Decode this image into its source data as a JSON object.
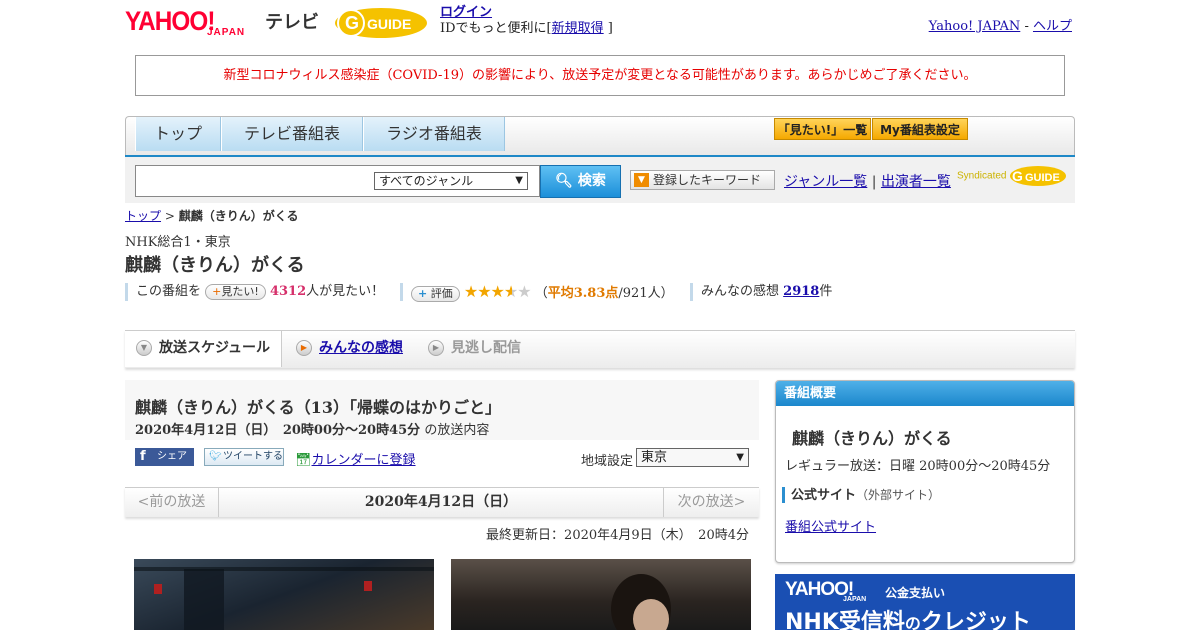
{
  "header": {
    "logo_yahoo": "YAHOO!",
    "logo_japan": "JAPAN",
    "logo_tv": "テレビ",
    "logo_gguide": "G GUIDE",
    "login_label": "ログイン",
    "id_text_prefix": "IDでもっと便利に[",
    "signup_label": "新規取得",
    "id_text_suffix": "]",
    "yahoo_japan_link": "Yahoo! JAPAN",
    "separator": "-",
    "help_link": "ヘルプ"
  },
  "notice": "新型コロナウィルス感染症（COVID-19）の影響により、放送予定が変更となる可能性があります。あらかじめご了承ください。",
  "nav": {
    "tabs": [
      "トップ",
      "テレビ番組表",
      "ラジオ番組表"
    ],
    "btn_mitai": "「見たい!」一覧",
    "btn_my": "My番組表設定"
  },
  "search": {
    "placeholder": "",
    "genre": "すべてのジャンル",
    "button": "検索",
    "keyword_btn": "登録したキーワード",
    "genre_list": "ジャンル一覧",
    "divider": "|",
    "performer_list": "出演者一覧",
    "syndicated": "Syndicated"
  },
  "breadcrumb": {
    "home": "トップ",
    "sep": ">",
    "current": "麒麟（きりん）がくる"
  },
  "program": {
    "station": "NHK総合1・東京",
    "title": "麒麟（きりん）がくる",
    "mitai_prefix": "この番組を",
    "mitai_btn": "見たい!",
    "mitai_count": "4312",
    "mitai_suffix": "人が見たい！",
    "rate_btn": "評価",
    "rating": 3.83,
    "stars_full": "★★★",
    "stars_half": "★",
    "stars_empty": "★",
    "avg_open": "（",
    "avg_label": "平均3.83点",
    "avg_count": "/921人",
    "avg_close": "）",
    "impressions_prefix": "みんなの感想",
    "impressions_count": "2918",
    "impressions_suffix": "件"
  },
  "subtabs": {
    "schedule": "放送スケジュール",
    "impressions": "みんなの感想",
    "vod": "見逃し配信"
  },
  "episode": {
    "title": "麒麟（きりん）がくる（13）「帰蝶のはかりごと」",
    "date_time": "2020年4月12日（日）　20時00分～20時45分",
    "date_suffix": "の放送内容",
    "share_fb": "シェア",
    "share_tw": "ツイートする",
    "calendar": "カレンダーに登録",
    "region_label": "地域設定",
    "region_value": "東京",
    "prev": "<前の放送",
    "current_date": "2020年4月12日（日）",
    "next": "次の放送>",
    "updated": "最終更新日：2020年4月9日（木）　20時4分"
  },
  "summary": {
    "header": "番組概要",
    "title": "麒麟（きりん）がくる",
    "regular": "レギュラー放送：日曜 20時00分～20時45分",
    "official": "公式サイト",
    "official_note": "（外部サイト）",
    "official_link": "番組公式サイト"
  },
  "ad": {
    "logo_yahoo": "YAHOO!",
    "logo_japan": "JAPAN",
    "pay": "公金支払い",
    "main_prefix": "NHK受信料",
    "main_suffix": "クレジット"
  },
  "colors": {
    "accent_blue": "#1e88c7",
    "notice_red": "#e60000",
    "yahoo_red": "#ff0033",
    "star_orange": "#f2a500",
    "count_pink": "#d6306b",
    "avg_orange": "#e07a00"
  }
}
